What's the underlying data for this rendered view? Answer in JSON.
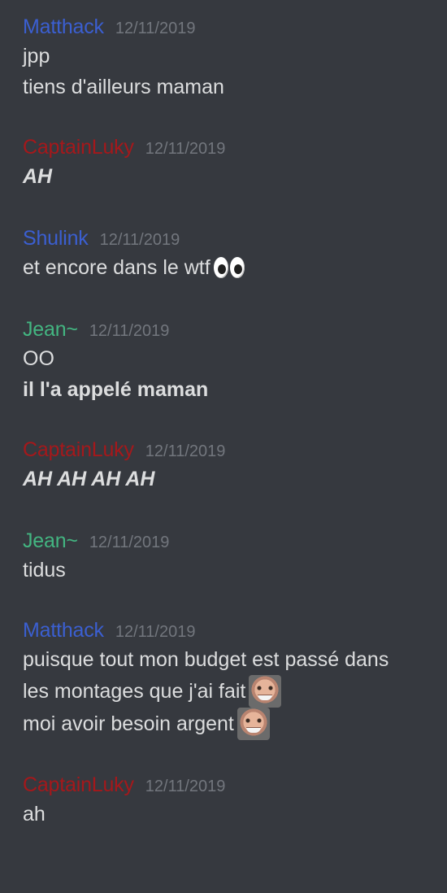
{
  "colors": {
    "background": "#36393f",
    "text": "#dcddde",
    "timestamp": "#72767d",
    "blue_user": "#3b5fd1",
    "red_user": "#a5181b",
    "green_user": "#43b581"
  },
  "messages": [
    {
      "author": "Matthack",
      "color": "#3b5fd1",
      "timestamp": "12/11/2019",
      "lines": [
        "jpp",
        "tiens d'ailleurs maman"
      ]
    },
    {
      "author": "CaptainLuky",
      "color": "#a5181b",
      "timestamp": "12/11/2019",
      "lines": [
        "AH"
      ]
    },
    {
      "author": "Shulink",
      "color": "#3b5fd1",
      "timestamp": "12/11/2019",
      "lines": [
        "et encore dans le wtf"
      ],
      "emoji": "eyes-emoji"
    },
    {
      "author": "Jean~",
      "color": "#43b581",
      "timestamp": "12/11/2019",
      "lines": [
        "OO",
        "il l'a appelé maman"
      ]
    },
    {
      "author": "CaptainLuky",
      "color": "#a5181b",
      "timestamp": "12/11/2019",
      "lines": [
        "AH AH AH AH"
      ]
    },
    {
      "author": "Jean~",
      "color": "#43b581",
      "timestamp": "12/11/2019",
      "lines": [
        "tidus"
      ]
    },
    {
      "author": "Matthack",
      "color": "#3b5fd1",
      "timestamp": "12/11/2019",
      "lines": [
        "puisque tout mon budget est passé dans",
        "les montages que j'ai fait",
        "moi avoir besoin argent"
      ],
      "emoji": "harold-emoji"
    },
    {
      "author": "CaptainLuky",
      "color": "#a5181b",
      "timestamp": "12/11/2019",
      "lines": [
        "ah"
      ]
    }
  ]
}
